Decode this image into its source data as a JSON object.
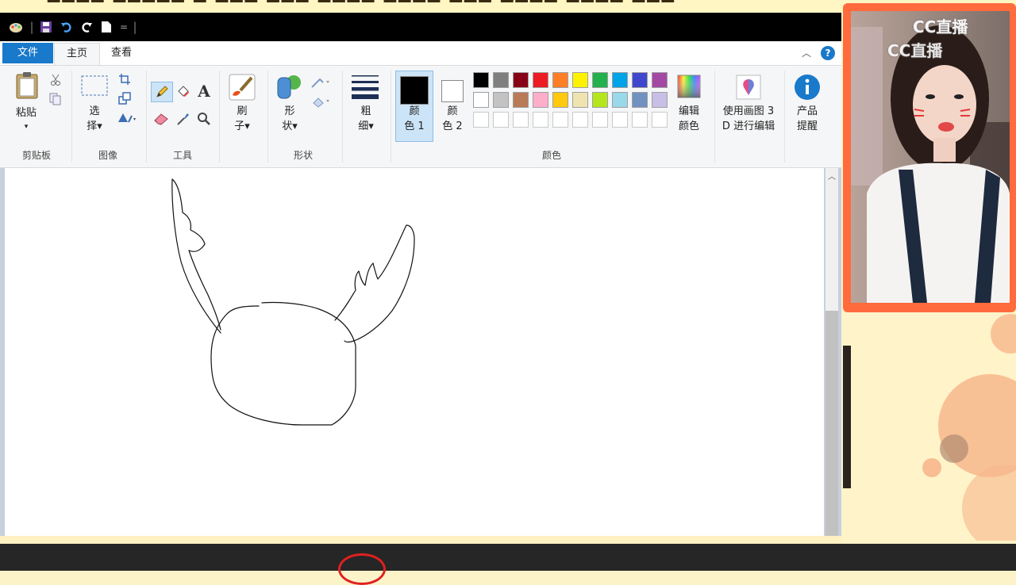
{
  "quick_access": {
    "title_separator": "|",
    "dropdown": "="
  },
  "tabs": {
    "file": "文件",
    "home": "主页",
    "view": "查看"
  },
  "ribbon": {
    "clipboard": {
      "paste": "粘贴",
      "group": "剪贴板"
    },
    "image": {
      "select": "选\n择▾",
      "group": "图像"
    },
    "tools": {
      "text_tool": "A",
      "group": "工具"
    },
    "brushes": {
      "label": "刷\n子▾"
    },
    "shapes": {
      "label": "形\n状▾",
      "group": "形状"
    },
    "size": {
      "label": "粗\n细▾"
    },
    "colors": {
      "color1": "颜\n色 1",
      "color2": "颜\n色 2",
      "edit_colors": "编辑\n颜色",
      "group": "颜色",
      "color1_value": "#000000",
      "color2_value": "#ffffff",
      "palette_row1": [
        "#000000",
        "#7f7f7f",
        "#880015",
        "#ed1c24",
        "#ff7f27",
        "#fff200",
        "#22b14c",
        "#00a2e8",
        "#3f48cc",
        "#a349a4"
      ],
      "palette_row2": [
        "#ffffff",
        "#c3c3c3",
        "#b97a57",
        "#ffaec9",
        "#ffc90e",
        "#efe4b0",
        "#b5e61d",
        "#99d9ea",
        "#7092be",
        "#c8bfe7"
      ]
    },
    "paint3d": {
      "label": "使用画图 3\nD 进行编辑"
    },
    "product_alert": {
      "label": "产品\n提醒"
    }
  },
  "webcam": {
    "watermark": "CC直播",
    "border_color": "#ff6b3d"
  },
  "icons": {
    "collapse": "︿",
    "help": "?",
    "scroll_up": "︿"
  }
}
